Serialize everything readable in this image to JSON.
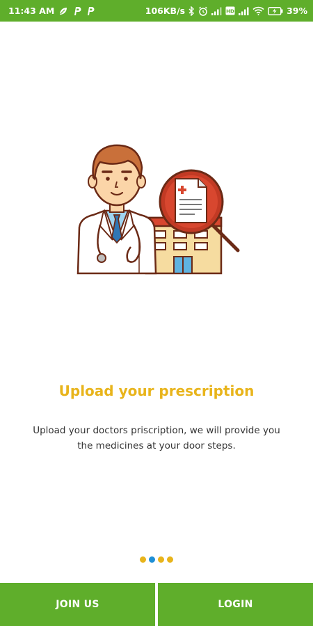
{
  "status_bar": {
    "time": "11:43 AM",
    "network_speed": "106KB/s",
    "battery_percent": "39%",
    "background_color": "#5fae2b",
    "icons": [
      "leaf-icon",
      "p-icon",
      "p-icon",
      "bluetooth-icon",
      "alarm-icon",
      "signal-icon",
      "hd-icon",
      "signal-icon",
      "wifi-icon",
      "battery-charging-icon"
    ]
  },
  "onboarding": {
    "title": "Upload your prescription",
    "description": "Upload your doctors priscription, we will provide you the medicines at your door steps.",
    "title_color": "#e8b41b",
    "pages_total": 4,
    "current_page": 2
  },
  "buttons": {
    "join_label": "JOIN US",
    "login_label": "LOGIN",
    "color": "#5fae2b"
  }
}
